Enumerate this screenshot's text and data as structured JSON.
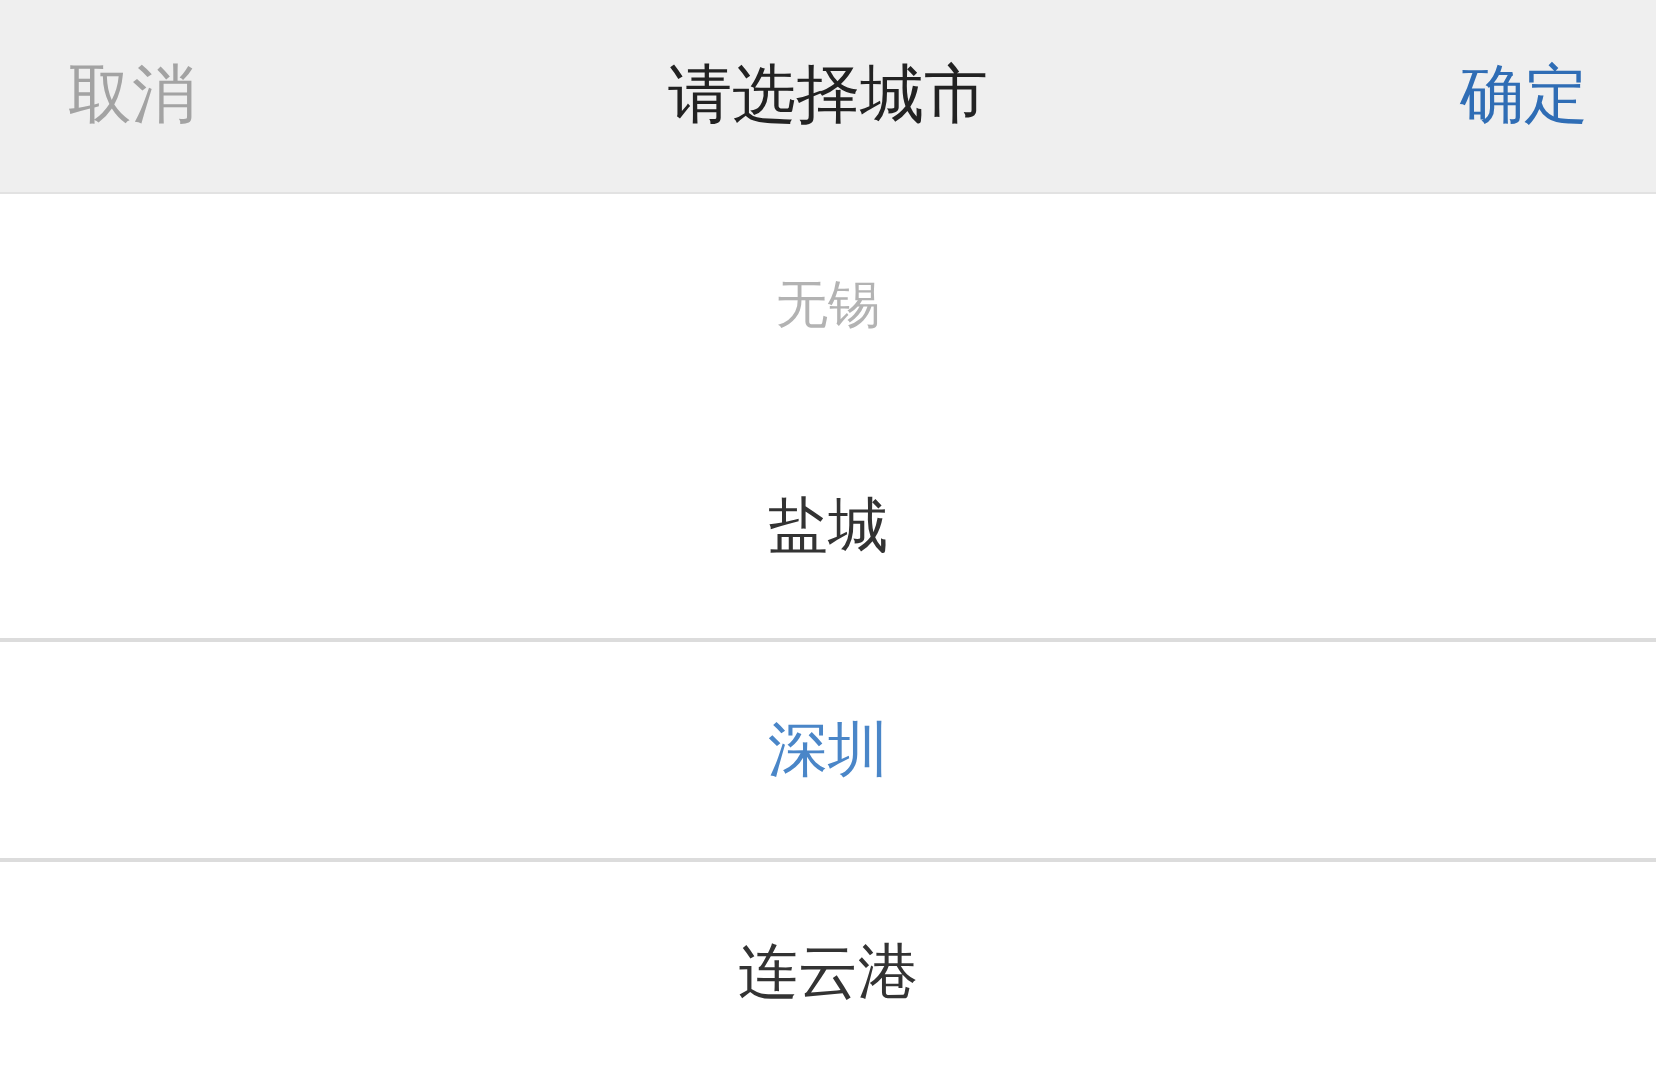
{
  "header": {
    "cancel": "取消",
    "title": "请选择城市",
    "confirm": "确定"
  },
  "options": [
    {
      "label": "无锡",
      "selected": false,
      "faded": true
    },
    {
      "label": "盐城",
      "selected": false,
      "faded": false
    },
    {
      "label": "深圳",
      "selected": true,
      "faded": false
    },
    {
      "label": "连云港",
      "selected": false,
      "faded": false
    }
  ]
}
